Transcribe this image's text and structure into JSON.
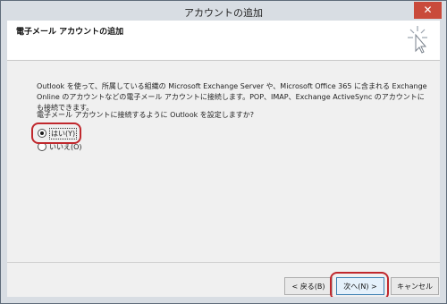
{
  "window": {
    "title": "アカウントの追加",
    "close_label": "✕"
  },
  "header": {
    "title": "電子メール アカウントの追加"
  },
  "content": {
    "description": "Outlook を使って、所属している組織の Microsoft Exchange Server や、Microsoft Office 365 に含まれる Exchange Online のアカウントなどの電子メール アカウントに接続します。POP、IMAP、Exchange ActiveSync のアカウントにも接続できます。",
    "question": "電子メール アカウントに接続するように Outlook を設定しますか?",
    "options": [
      {
        "label": "はい(Y)",
        "selected": true
      },
      {
        "label": "いいえ(O)",
        "selected": false
      }
    ]
  },
  "buttons": {
    "back": "< 戻る(B)",
    "next": "次へ(N) >",
    "cancel": "キャンセル"
  }
}
